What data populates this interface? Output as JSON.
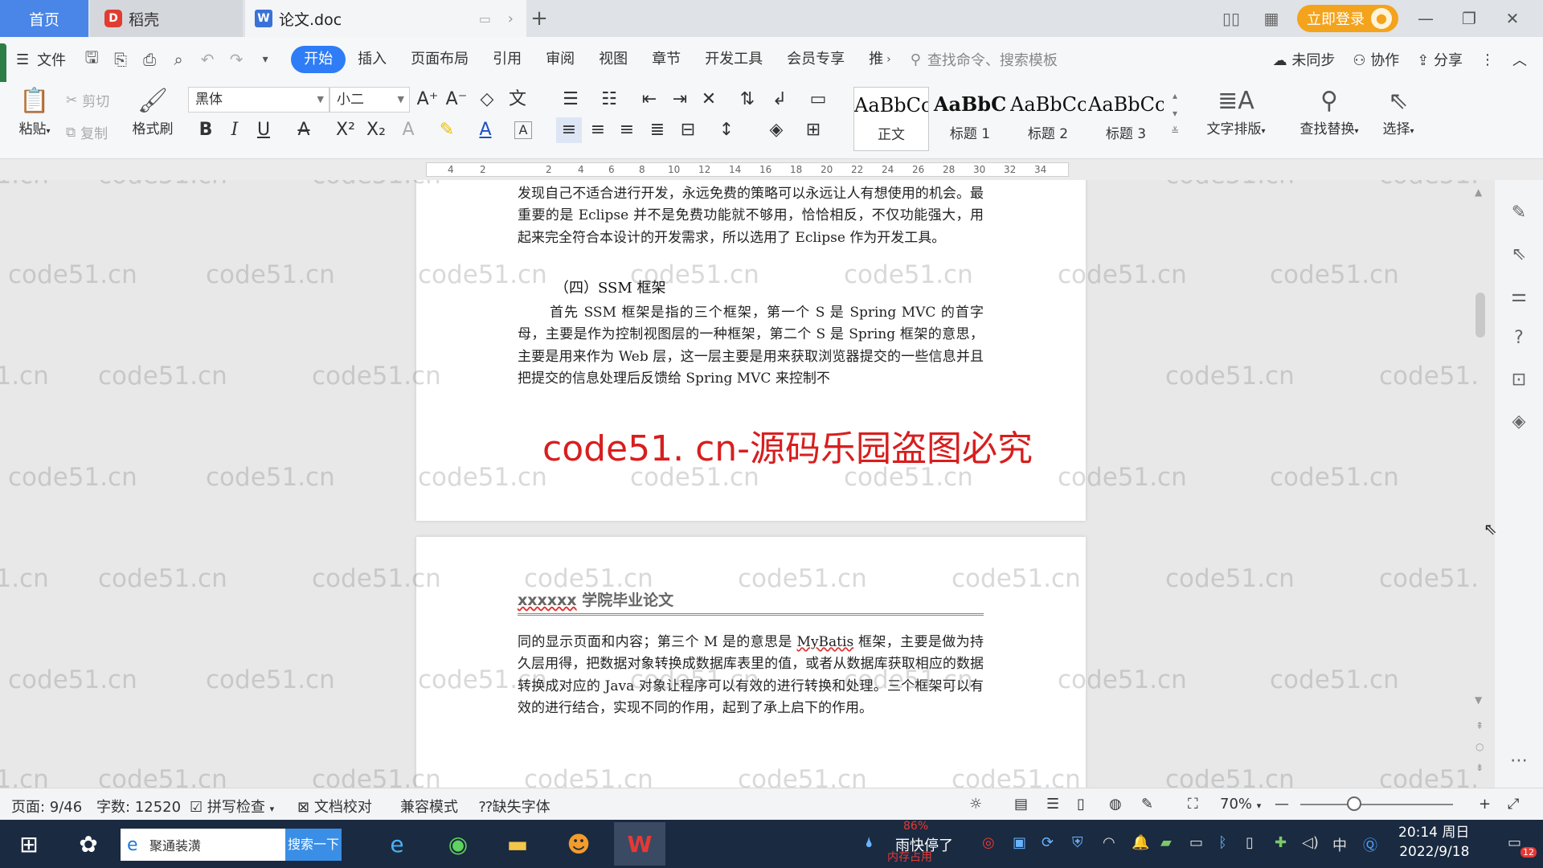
{
  "tabs": {
    "home": "首页",
    "daoke": "稻壳",
    "document": "论文.doc"
  },
  "title_right": {
    "login": "立即登录"
  },
  "menu": {
    "file": "文件",
    "items": [
      "开始",
      "插入",
      "页面布局",
      "引用",
      "审阅",
      "视图",
      "章节",
      "开发工具",
      "会员专享",
      "推"
    ],
    "search_command": "查找命令、搜索模板",
    "sync": "未同步",
    "collab": "协作",
    "share": "分享"
  },
  "ribbon": {
    "paste": "粘贴",
    "cut": "剪切",
    "copy": "复制",
    "format_painter": "格式刷",
    "font_name": "黑体",
    "font_size": "小二",
    "styles": [
      {
        "preview": "AaBbCc",
        "label": "正文"
      },
      {
        "preview": "AaBbC",
        "label": "标题 1"
      },
      {
        "preview": "AaBbCc",
        "label": "标题 2"
      },
      {
        "preview": "AaBbCc",
        "label": "标题 3"
      }
    ],
    "text_layout": "文字排版",
    "find_replace": "查找替换",
    "select": "选择"
  },
  "ruler": {
    "ticks": [
      "4",
      "2",
      "",
      "2",
      "4",
      "6",
      "8",
      "10",
      "12",
      "14",
      "16",
      "18",
      "20",
      "22",
      "24",
      "26",
      "28",
      "30",
      "32",
      "34"
    ]
  },
  "document": {
    "page1_para1": "发现自己不适合进行开发，永远免费的策略可以永远让人有想使用的机会。最重要的是 Eclipse 并不是免费功能就不够用，恰恰相反，不仅功能强大，用起来完全符合本设计的开发需求，所以选用了 Eclipse 作为开发工具。",
    "heading": "（四）SSM 框架",
    "page1_para2": "首先 SSM 框架是指的三个框架，第一个 S 是 Spring MVC 的首字母，主要是作为控制视图层的一种框架，第二个 S 是 Spring 框架的意思，主要是用来作为 Web 层，这一层主要是用来获取浏览器提交的一些信息并且把提交的信息处理后反馈给 Spring MVC 来控制不",
    "header_prefix": "xxxxxx",
    "header_suffix": " 学院毕业论文",
    "page2_para_a": "同的显示页面和内容；第三个 M 是的意思是 ",
    "page2_mybatis": "MyBatis",
    "page2_para_b": " 框架，主要是做为持久层用得，把数据对象转换成数据库表里的值，或者从数据库获取相应的数据转换成对应的 Java 对象让程序可以有效的进行转换和处理。三个框架可以有效的进行结合，实现不同的作用，起到了承上启下的作用。"
  },
  "watermark": {
    "red": "code51. cn-源码乐园盗图必究",
    "tile": "code51.cn"
  },
  "status": {
    "page": "页面: 9/46",
    "words": "字数: 12520",
    "spell": "拼写检查",
    "proof": "文档校对",
    "compat": "兼容模式",
    "missing_font": "缺失字体",
    "zoom": "70%"
  },
  "taskbar": {
    "search_text": "聚通装潢",
    "search_button": "搜索一下",
    "weather": "雨快停了",
    "mem": "86%",
    "mem_label": "内存占用",
    "ime": "中",
    "time": "20:14 周日",
    "date": "2022/9/18",
    "notif": "12"
  }
}
